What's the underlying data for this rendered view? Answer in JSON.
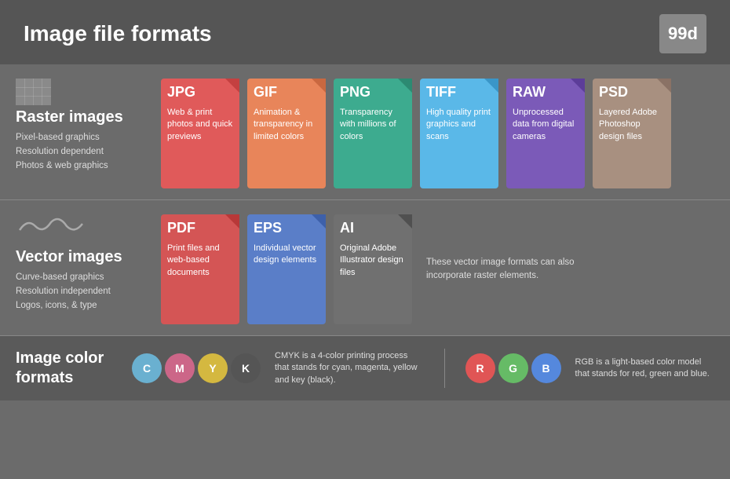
{
  "header": {
    "title": "Image file formats",
    "logo": "99d"
  },
  "raster": {
    "heading": "Raster images",
    "lines": [
      "Pixel-based graphics",
      "Resolution dependent",
      "Photos & web graphics"
    ],
    "cards": [
      {
        "id": "jpg",
        "label": "JPG",
        "desc": "Web & print photos and quick previews",
        "color": "#e05a5a",
        "dark": "#c44040"
      },
      {
        "id": "gif",
        "label": "GIF",
        "desc": "Animation & transparency in limited colors",
        "color": "#e8855a",
        "dark": "#c96840"
      },
      {
        "id": "png",
        "label": "PNG",
        "desc": "Transparency with millions of colors",
        "color": "#3dab8f",
        "dark": "#2c8a72"
      },
      {
        "id": "tiff",
        "label": "TIFF",
        "desc": "High quality print graphics and scans",
        "color": "#5ab8e8",
        "dark": "#3a96c8"
      },
      {
        "id": "raw",
        "label": "RAW",
        "desc": "Unprocessed data from digital cameras",
        "color": "#7b5ab8",
        "dark": "#5c3d99"
      },
      {
        "id": "psd",
        "label": "PSD",
        "desc": "Layered Adobe Photoshop design files",
        "color": "#a89080",
        "dark": "#8a7265"
      }
    ]
  },
  "vector": {
    "heading": "Vector images",
    "lines": [
      "Curve-based graphics",
      "Resolution independent",
      "Logos, icons, & type"
    ],
    "cards": [
      {
        "id": "pdf",
        "label": "PDF",
        "desc": "Print files and web-based documents",
        "color": "#d45555",
        "dark": "#b83838"
      },
      {
        "id": "eps",
        "label": "EPS",
        "desc": "Individual vector design elements",
        "color": "#5a7ec8",
        "dark": "#3d60aa"
      },
      {
        "id": "ai",
        "label": "AI",
        "desc": "Original Adobe Illustrator design files",
        "color": "#707070",
        "dark": "#505050"
      }
    ],
    "note": "These vector image formats can also incorporate raster elements."
  },
  "color_formats": {
    "heading": "Image color formats",
    "cmyk": {
      "letters": [
        "C",
        "M",
        "Y",
        "K"
      ],
      "colors": [
        "#6ab0d0",
        "#cc6688",
        "#d4b840",
        "#555555"
      ],
      "desc": "CMYK is a 4-color printing process that stands for cyan, magenta, yellow and key (black)."
    },
    "rgb": {
      "letters": [
        "R",
        "G",
        "B"
      ],
      "colors": [
        "#e05555",
        "#66bb66",
        "#5588dd"
      ],
      "desc": "RGB is a light-based color model that stands for red, green and blue."
    }
  }
}
